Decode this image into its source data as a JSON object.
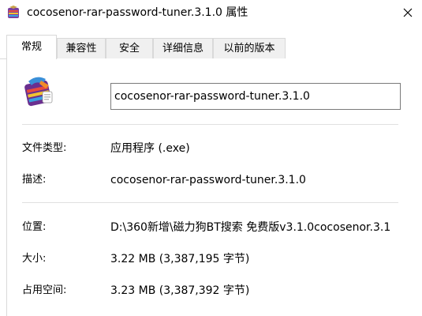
{
  "window": {
    "title": "cocosenor-rar-password-tuner.3.1.0 属性",
    "close_icon": "close-icon"
  },
  "tabs": [
    {
      "label": "常规",
      "active": true
    },
    {
      "label": "兼容性",
      "active": false
    },
    {
      "label": "安全",
      "active": false
    },
    {
      "label": "详细信息",
      "active": false
    },
    {
      "label": "以前的版本",
      "active": false
    }
  ],
  "general": {
    "file_name": "cocosenor-rar-password-tuner.3.1.0",
    "app_icon": "winrar-icon",
    "rows": [
      {
        "label": "文件类型:",
        "value": "应用程序 (.exe)"
      },
      {
        "label": "描述:",
        "value": "cocosenor-rar-password-tuner.3.1.0"
      },
      {
        "label": "位置:",
        "value": "D:\\360新增\\磁力狗BT搜索 免费版v3.1.0cocosenor.3.1"
      },
      {
        "label": "大小:",
        "value": "3.22 MB (3,387,195 字节)"
      },
      {
        "label": "占用空间:",
        "value": "3.23 MB (3,387,392 字节)"
      }
    ]
  },
  "colors": {
    "border": "#d9d9d9",
    "field_border": "#7a7a7a",
    "tab_inactive_bg": "#f0f0f0"
  }
}
